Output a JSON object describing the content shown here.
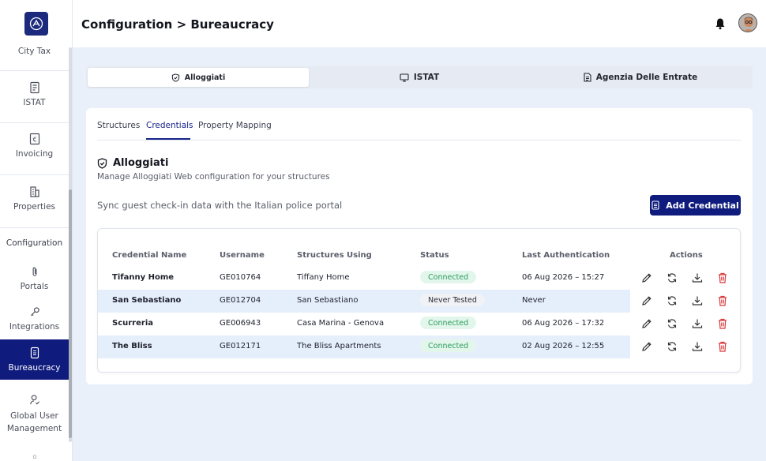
{
  "sidebar": {
    "items": [
      {
        "label": "City Tax"
      },
      {
        "label": "ISTAT"
      },
      {
        "label": "Invoicing"
      },
      {
        "label": "Properties"
      },
      {
        "label": "Portals"
      },
      {
        "label": "Integrations"
      },
      {
        "label": "Bureaucracy"
      },
      {
        "label": "Global User Management"
      }
    ],
    "section_label": "Configuration"
  },
  "header": {
    "title": "Configuration > Bureaucracy"
  },
  "top_tabs": [
    {
      "label": "Alloggiati",
      "icon": "shield-icon"
    },
    {
      "label": "ISTAT",
      "icon": "monitor-icon"
    },
    {
      "label": "Agenzia Delle Entrate",
      "icon": "document-icon"
    }
  ],
  "sub_tabs": [
    {
      "label": "Structures"
    },
    {
      "label": "Credentials"
    },
    {
      "label": "Property Mapping"
    }
  ],
  "section": {
    "title": "Alloggiati",
    "description": "Manage Alloggiati Web configuration for your structures",
    "sync_text": "Sync guest check-in data with the Italian police portal",
    "add_button": "Add Credential"
  },
  "table": {
    "headers": [
      "Credential Name",
      "Username",
      "Structures Using",
      "Status",
      "Last Authentication",
      "Actions"
    ],
    "rows": [
      {
        "name": "Tifanny Home",
        "username": "GE010764",
        "structures": "Tiffany Home",
        "status": "Connected",
        "last_auth": "06 Aug 2026 – 15:27"
      },
      {
        "name": "San Sebastiano",
        "username": "GE012704",
        "structures": "San Sebastiano",
        "status": "Never Tested",
        "last_auth": "Never"
      },
      {
        "name": "Scurreria",
        "username": "GE006943",
        "structures": "Casa Marina - Genova",
        "status": "Connected",
        "last_auth": "06 Aug 2026 – 17:32"
      },
      {
        "name": "The Bliss",
        "username": "GE012171",
        "structures": "The Bliss Apartments",
        "status": "Connected",
        "last_auth": "02 Aug 2026 – 12:55"
      }
    ]
  },
  "colors": {
    "primary": "#0f1b7d",
    "connected": "#2b9c5c",
    "delete": "#d9383a"
  }
}
